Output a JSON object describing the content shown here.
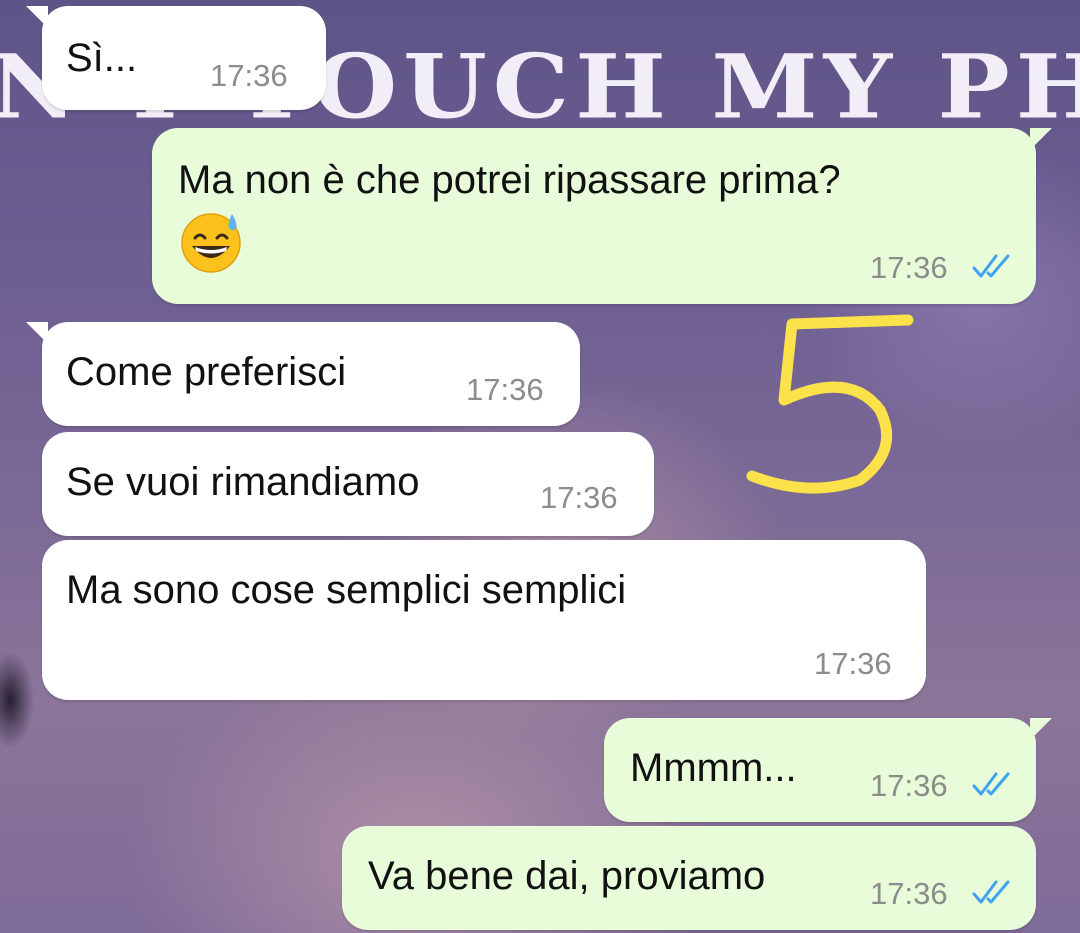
{
  "wallpaper": {
    "text": "N'T TOUCH MY PHO"
  },
  "annotation": {
    "number": "5",
    "color": "#fbe24a"
  },
  "colors": {
    "incoming_bubble": "#ffffff",
    "outgoing_bubble": "#e9fcd9",
    "timestamp": "#8c8c8c",
    "read_ticks": "#3fa3f0"
  },
  "messages": [
    {
      "direction": "incoming",
      "text": "Sì...",
      "time": "17:36"
    },
    {
      "direction": "outgoing",
      "text": "Ma non è che potrei ripassare prima?",
      "emoji": "grinning-face-with-sweat-icon",
      "time": "17:36",
      "status": "read"
    },
    {
      "direction": "incoming",
      "text": "Come preferisci",
      "time": "17:36"
    },
    {
      "direction": "incoming",
      "text": "Se vuoi rimandiamo",
      "time": "17:36"
    },
    {
      "direction": "incoming",
      "text": "Ma sono cose semplici semplici",
      "time": "17:36"
    },
    {
      "direction": "outgoing",
      "text": "Mmmm...",
      "time": "17:36",
      "status": "read"
    },
    {
      "direction": "outgoing",
      "text": "Va bene dai, proviamo",
      "time": "17:36",
      "status": "read"
    }
  ]
}
